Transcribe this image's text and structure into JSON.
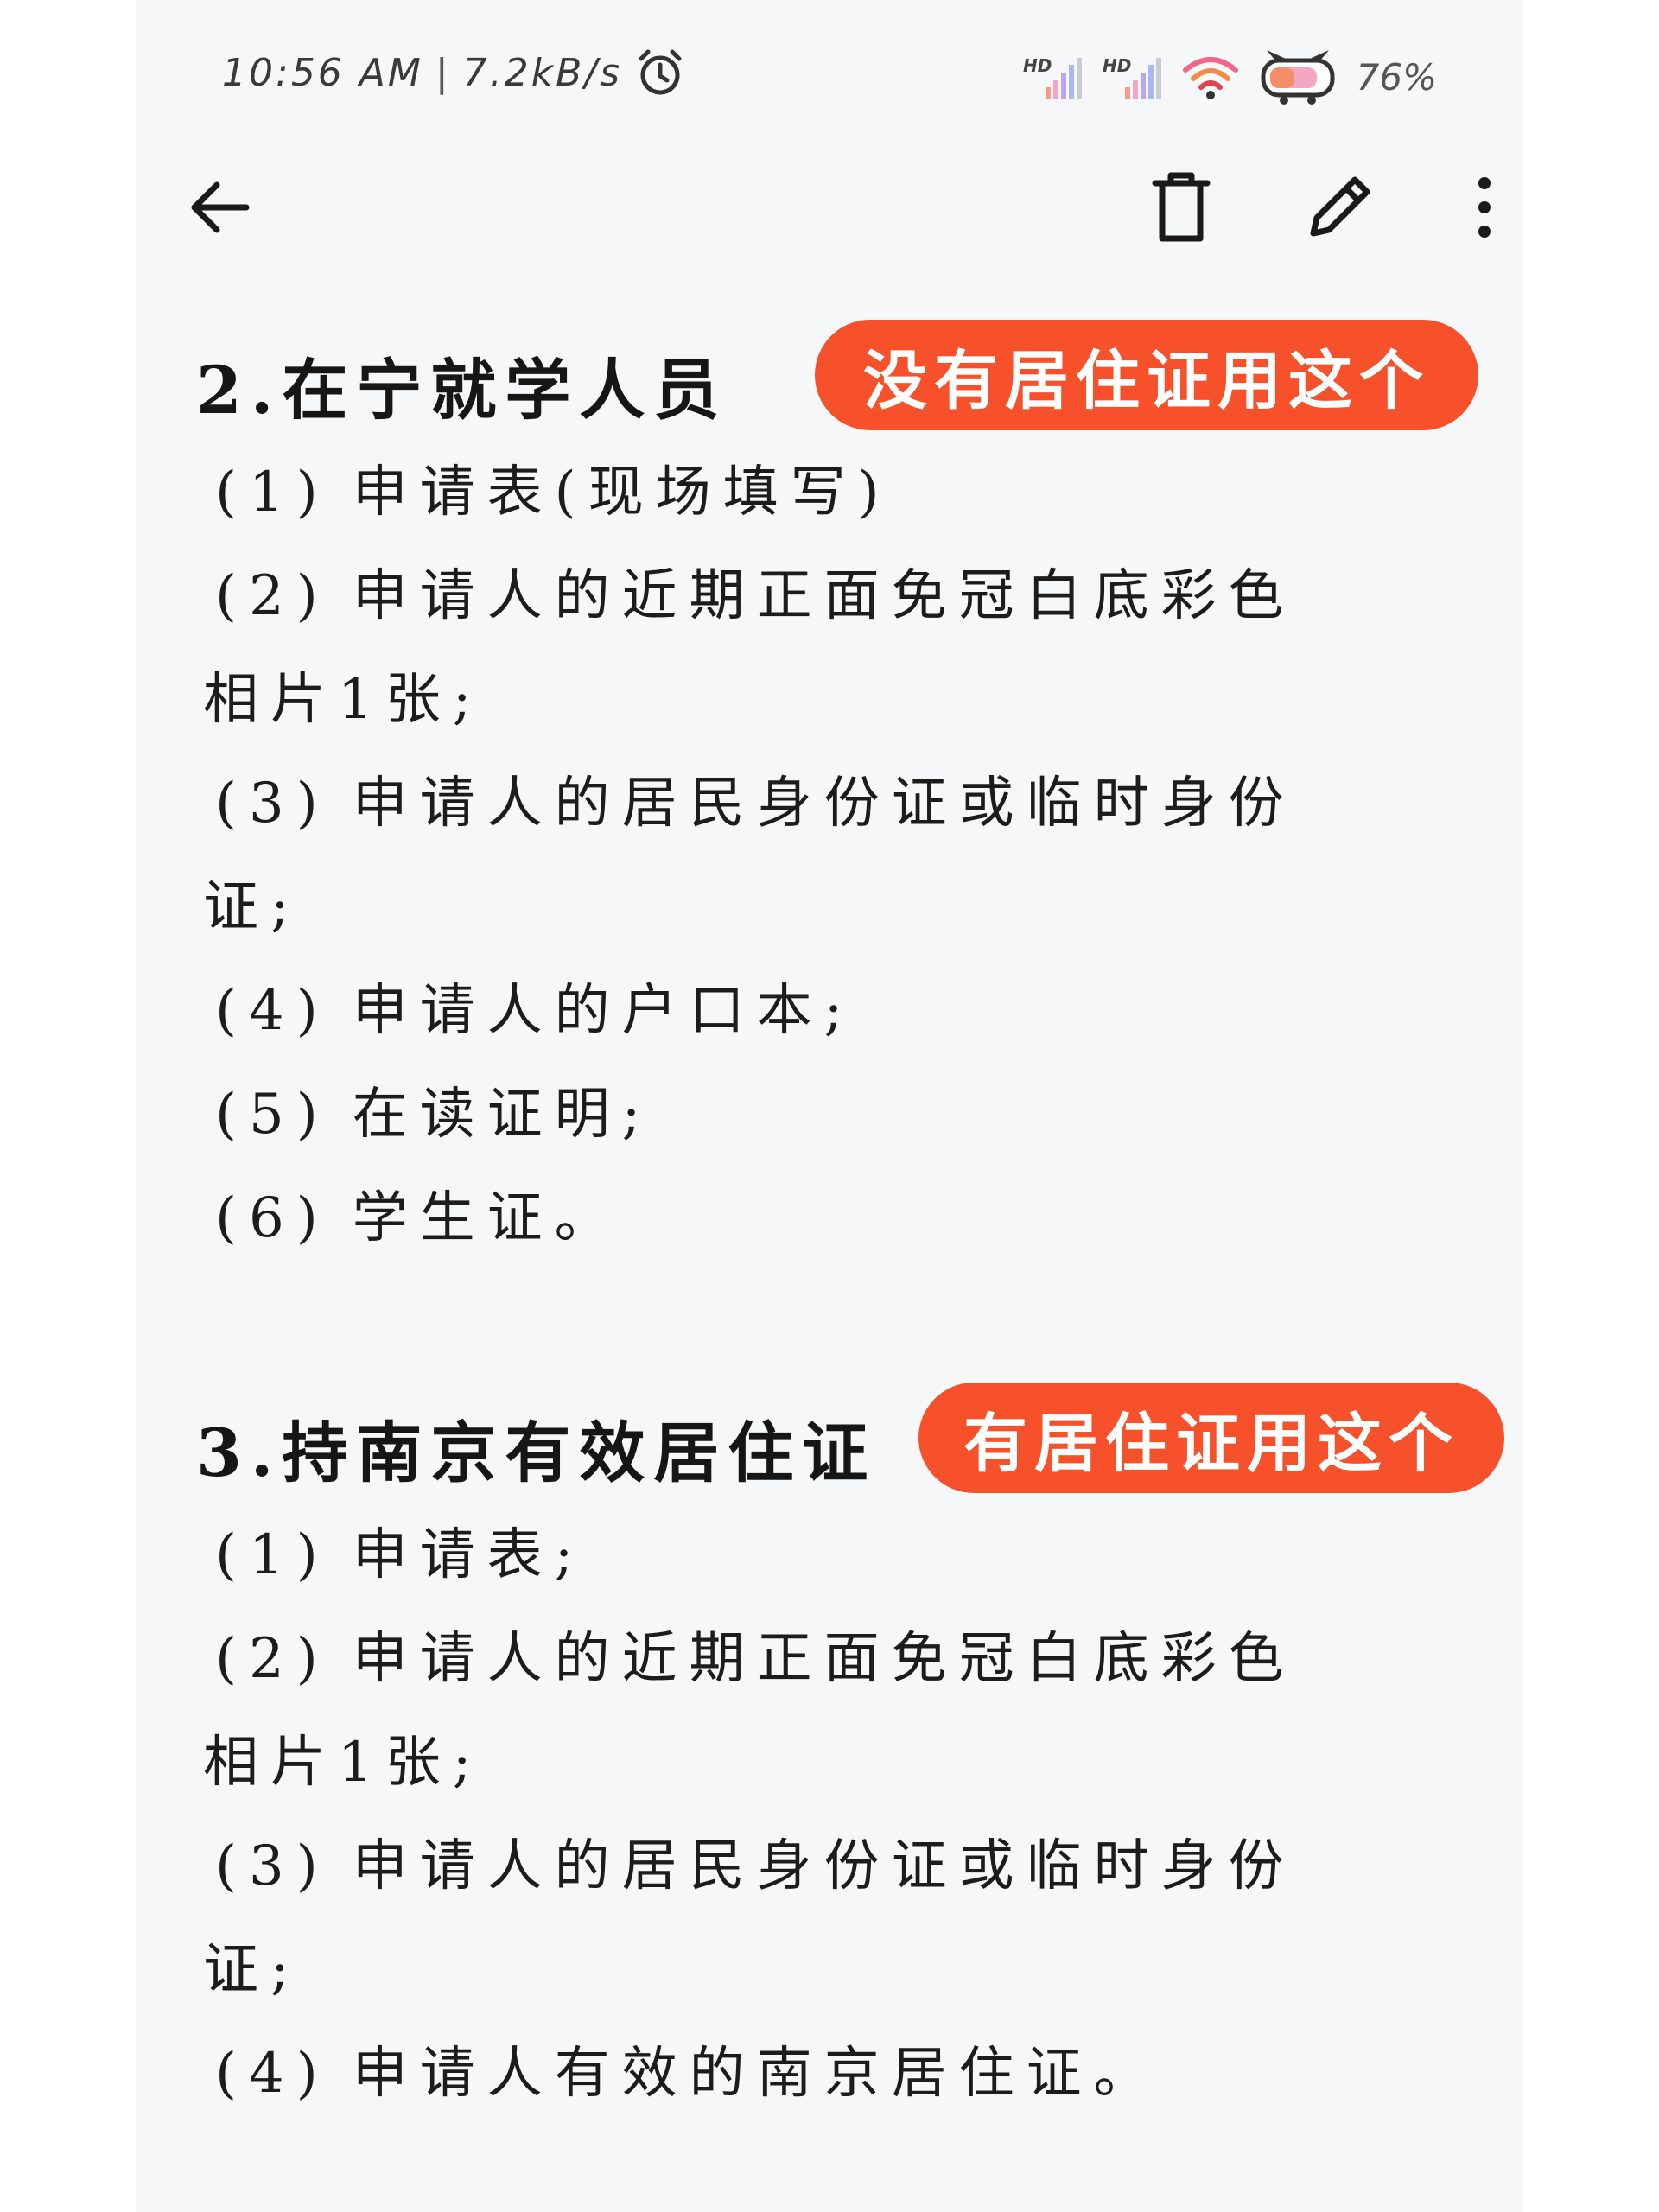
{
  "status_bar": {
    "time": "10:56 AM",
    "separator": "|",
    "net_speed": "7.2kB/s",
    "sim1_label": "HD",
    "sim2_label": "HD",
    "battery": "76%"
  },
  "toolbar": {
    "back_icon": "arrow-left-icon",
    "delete_icon": "trash-icon",
    "edit_icon": "pencil-icon",
    "more_icon": "more-vertical-icon"
  },
  "sections": [
    {
      "title": "2.在宁就学人员",
      "badge": "没有居住证用这个",
      "items": [
        {
          "num": "(1)",
          "text": "申请表(现场填写)",
          "wrap": ""
        },
        {
          "num": "(2)",
          "text": "申请人的近期正面免冠白底彩色",
          "wrap": "相片1张;"
        },
        {
          "num": "(3)",
          "text": "申请人的居民身份证或临时身份",
          "wrap": "证;"
        },
        {
          "num": "(4)",
          "text": "申请人的户口本;",
          "wrap": ""
        },
        {
          "num": "(5)",
          "text": "在读证明;",
          "wrap": ""
        },
        {
          "num": "(6)",
          "text": "学生证。",
          "wrap": ""
        }
      ]
    },
    {
      "title": "3.持南京有效居住证",
      "badge": "有居住证用这个",
      "items": [
        {
          "num": "(1)",
          "text": "申请表;",
          "wrap": ""
        },
        {
          "num": "(2)",
          "text": "申请人的近期正面免冠白底彩色",
          "wrap": "相片1张;"
        },
        {
          "num": "(3)",
          "text": "申请人的居民身份证或临时身份",
          "wrap": "证;"
        },
        {
          "num": "(4)",
          "text": "申请人有效的南京居住证。",
          "wrap": ""
        }
      ]
    }
  ],
  "colors": {
    "badge_bg": "#f6512b",
    "page_bg": "#f6f7f9",
    "text": "#1c1c1c"
  }
}
